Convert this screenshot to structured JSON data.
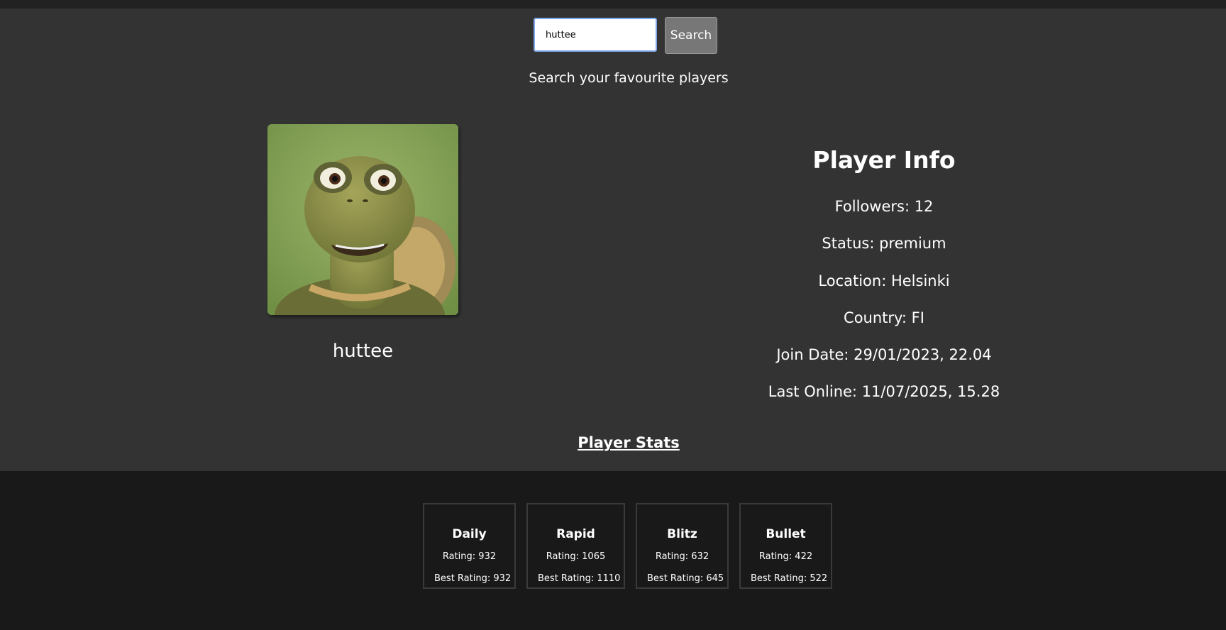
{
  "search": {
    "value": "huttee",
    "button_label": "Search",
    "subtitle": "Search your favourite players"
  },
  "profile": {
    "username": "huttee",
    "avatar_icon": "turtle-avatar-image"
  },
  "info": {
    "title": "Player Info",
    "rows": [
      "Followers: 12",
      "Status: premium",
      "Location: Helsinki",
      "Country: FI",
      "Join Date: 29/01/2023, 22.04",
      "Last Online: 11/07/2025, 15.28"
    ]
  },
  "stats": {
    "title": "Player Stats",
    "cards": [
      {
        "name": "Daily",
        "rating": "Rating: 932",
        "best": "Best Rating: 932"
      },
      {
        "name": "Rapid",
        "rating": "Rating: 1065",
        "best": "Best Rating: 1110"
      },
      {
        "name": "Blitz",
        "rating": "Rating: 632",
        "best": "Best Rating: 645"
      },
      {
        "name": "Bullet",
        "rating": "Rating: 422",
        "best": "Best Rating: 522"
      }
    ]
  },
  "colors": {
    "background": "#333333",
    "stats_background": "#191919",
    "button": "#777777"
  }
}
